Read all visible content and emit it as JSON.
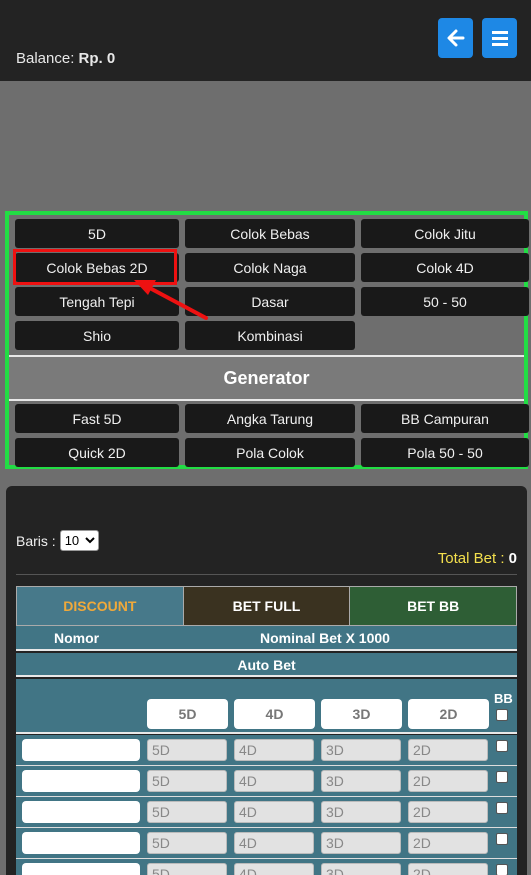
{
  "header": {
    "balance_label": "Balance:",
    "balance_value": "Rp. 0",
    "back_icon": "arrow-left-icon",
    "menu_icon": "hamburger-menu-icon"
  },
  "menu": {
    "games": [
      "5D",
      "Colok Bebas",
      "Colok Jitu",
      "Colok Bebas 2D",
      "Colok Naga",
      "Colok 4D",
      "Tengah Tepi",
      "Dasar",
      "50 - 50",
      "Shio",
      "Kombinasi"
    ],
    "generator_title": "Generator",
    "generators": [
      "Fast 5D",
      "Angka Tarung",
      "BB Campuran",
      "Quick 2D",
      "Pola Colok",
      "Pola 50 - 50"
    ]
  },
  "form": {
    "baris_label": "Baris :",
    "baris_value": "10",
    "total_bet_label": "Total Bet :",
    "total_bet_value": "0",
    "tabs": [
      "DISCOUNT",
      "BET FULL",
      "BET BB"
    ],
    "col_nomor": "Nomor",
    "col_nominal": "Nominal Bet X 1000",
    "auto_bet": "Auto Bet",
    "bb_label": "BB",
    "placeholders": [
      "5D",
      "4D",
      "3D",
      "2D"
    ]
  }
}
